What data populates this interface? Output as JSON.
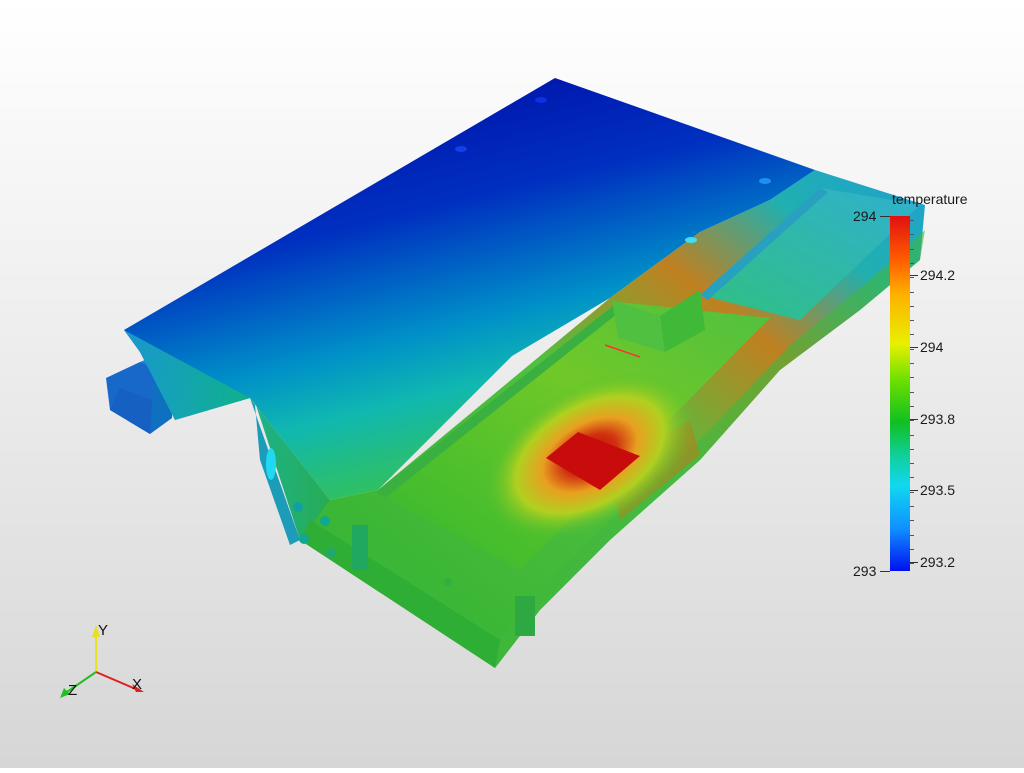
{
  "legend": {
    "title": "temperature",
    "range_max": "294",
    "range_min": "293",
    "ticks": [
      "294.2",
      "294",
      "293.8",
      "293.5",
      "293.2"
    ]
  },
  "orientation_axes": {
    "x_label": "X",
    "y_label": "Y",
    "z_label": "Z"
  },
  "colors": {
    "background_top": "#ffffff",
    "background_bottom": "#d6d6d6",
    "hot": "#d81010",
    "cold": "#0010c0",
    "x_axis": "#e02020",
    "y_axis": "#e8e020",
    "z_axis": "#20c020"
  }
}
